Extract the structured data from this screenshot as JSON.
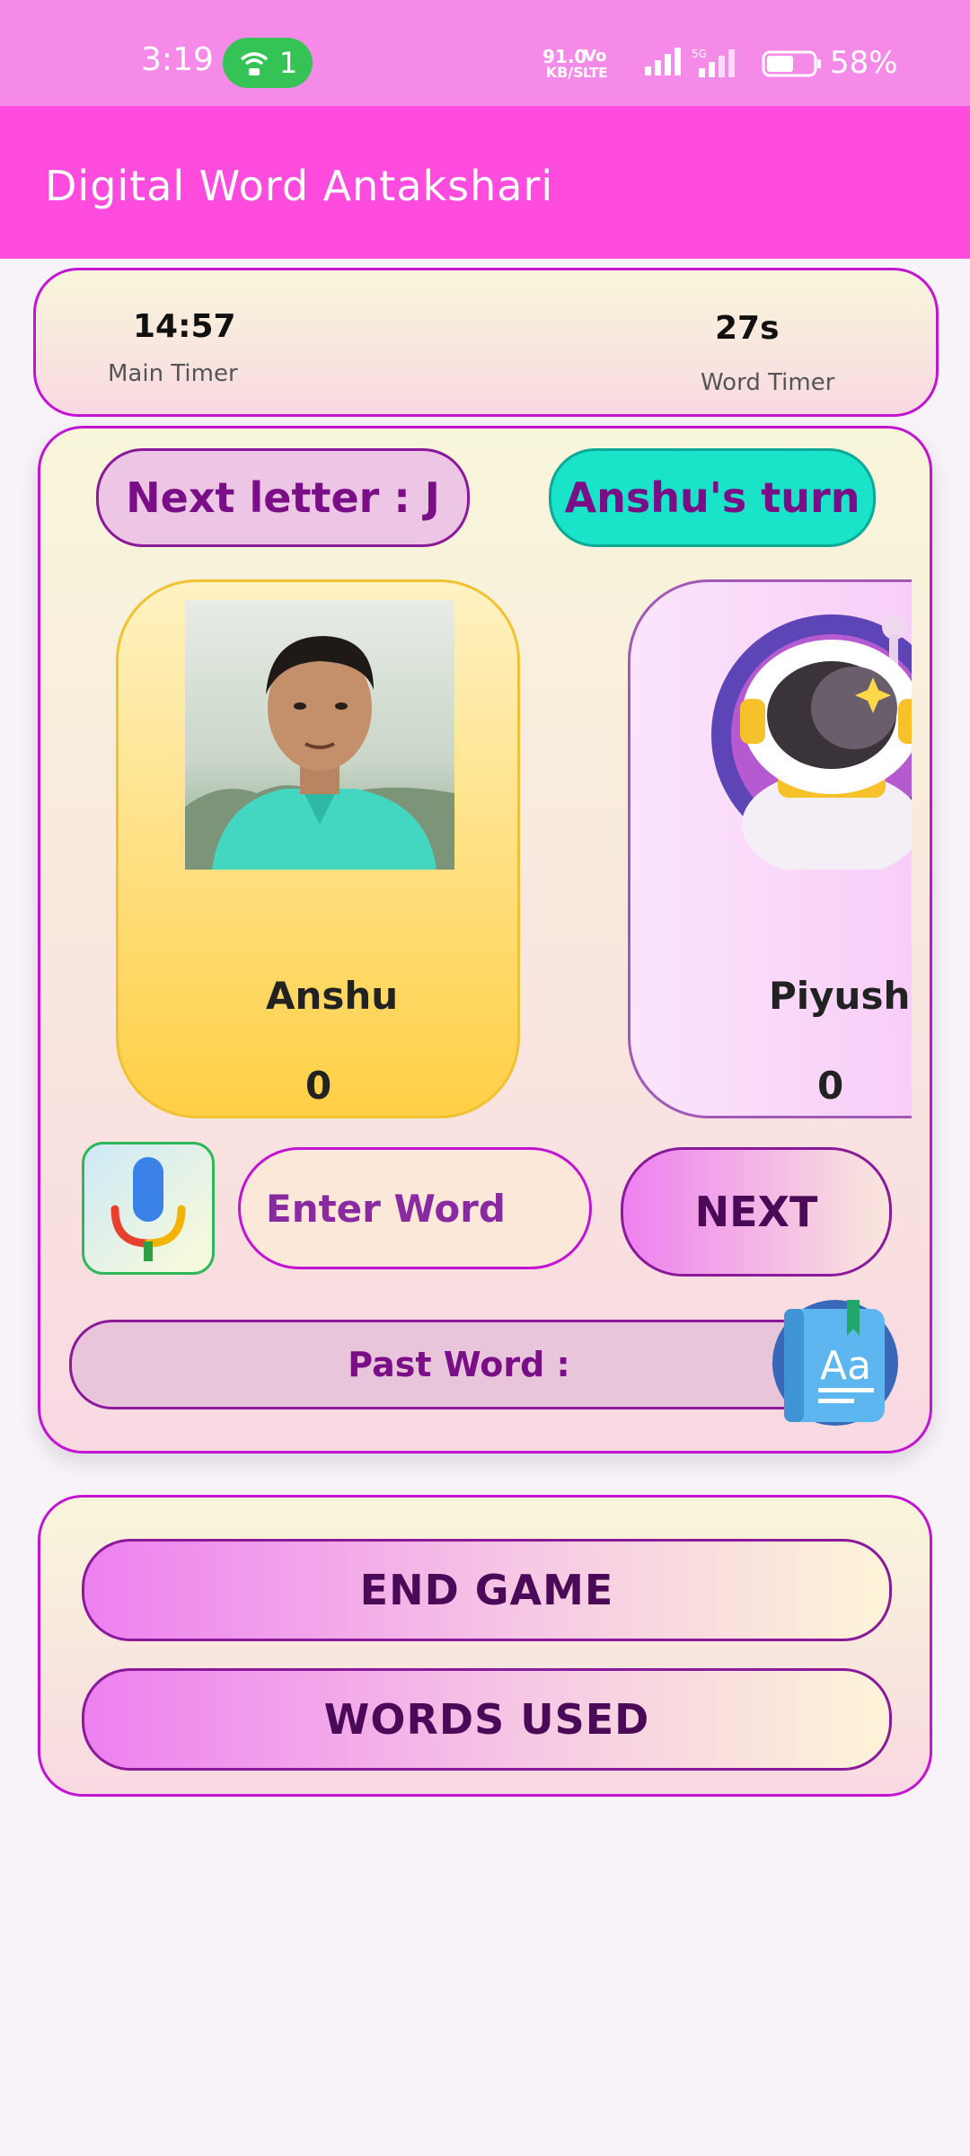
{
  "status_bar": {
    "time": "3:19",
    "hotspot_count": "1",
    "net_speed": "91.0",
    "net_unit": "KB/S",
    "volte_top": "Vo",
    "volte_bottom": "LTE",
    "signal_label": "5G",
    "battery_pct": "58%",
    "battery_level": 0.58
  },
  "app_bar": {
    "title": "Digital Word Antakshari"
  },
  "timers": {
    "main_value": "14:57",
    "main_label": "Main Timer",
    "word_value": "27s",
    "word_label": "Word Timer"
  },
  "game": {
    "next_letter": "Next letter : J",
    "turn": "Anshu's turn",
    "players": [
      {
        "name": "Anshu",
        "score": "0"
      },
      {
        "name": "Piyush",
        "score": "0"
      }
    ],
    "input_placeholder": "Enter Word",
    "next_button": "NEXT",
    "past_word": "Past Word :"
  },
  "actions": {
    "end_game": "END GAME",
    "words_used": "WORDS USED"
  },
  "colors": {
    "status_bar": "#f58ae8",
    "app_bar": "#ff4bde",
    "card_border": "#c214d2",
    "turn_badge": "#19e3c8",
    "text_purple": "#7a0e86"
  }
}
